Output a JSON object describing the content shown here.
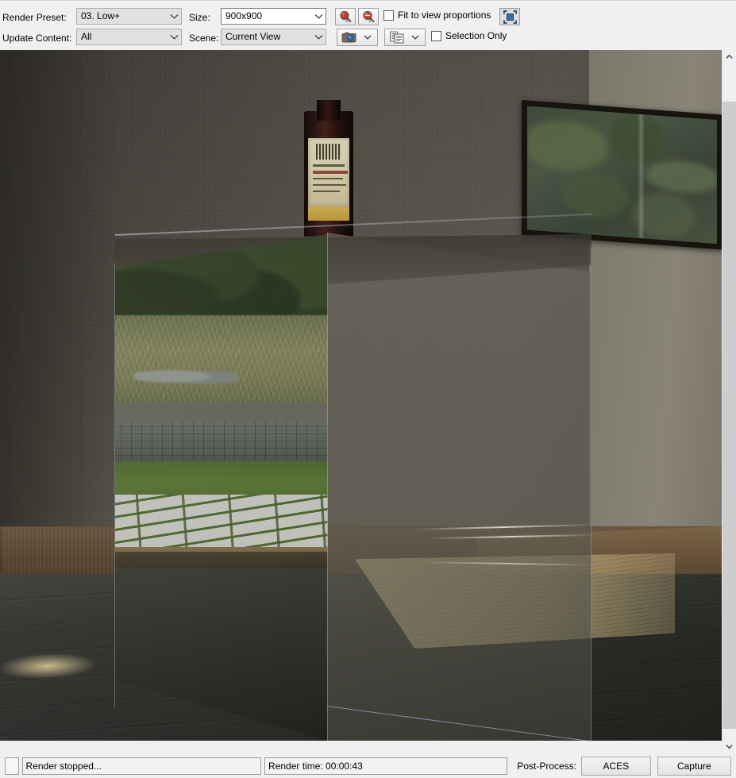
{
  "toolbar": {
    "render_preset_label": "Render Preset:",
    "render_preset_value": "03. Low+",
    "update_content_label": "Update Content:",
    "update_content_value": "All",
    "size_label": "Size:",
    "size_value": "900x900",
    "scene_label": "Scene:",
    "scene_value": "Current View",
    "zoom_in_tooltip": "zoom-in-icon",
    "zoom_out_tooltip": "zoom-out-icon",
    "fit_to_view_label": "Fit to view proportions",
    "fit_to_view_checked": false,
    "fit_region_icon": "fit-region-icon",
    "camera_icon": "camera-icon",
    "copy_icon": "copy-to-clipboard-icon",
    "selection_only_label": "Selection Only",
    "selection_only_checked": false
  },
  "viewport": {
    "scene_description": "Interior 3D render: glass cube on dark wood floor, wine bottle on table behind, framed mirror on wall, garden reflection through glass",
    "scrollbar_up": "▲",
    "scrollbar_down": "▼"
  },
  "statusbar": {
    "status_message": "Render stopped...",
    "render_time": "Render time: 00:00:43",
    "post_process_label": "Post-Process:",
    "aces_button": "ACES",
    "capture_button": "Capture"
  },
  "colors": {
    "panel_bg": "#f0f0f0",
    "combo_disabled_bg": "#e1e1e1",
    "combo_editable_bg": "#ffffff",
    "border": "#acacac",
    "accent_blue": "#2b6ca3",
    "accent_red": "#c0392b",
    "scroll_thumb": "#cdcdcd"
  }
}
